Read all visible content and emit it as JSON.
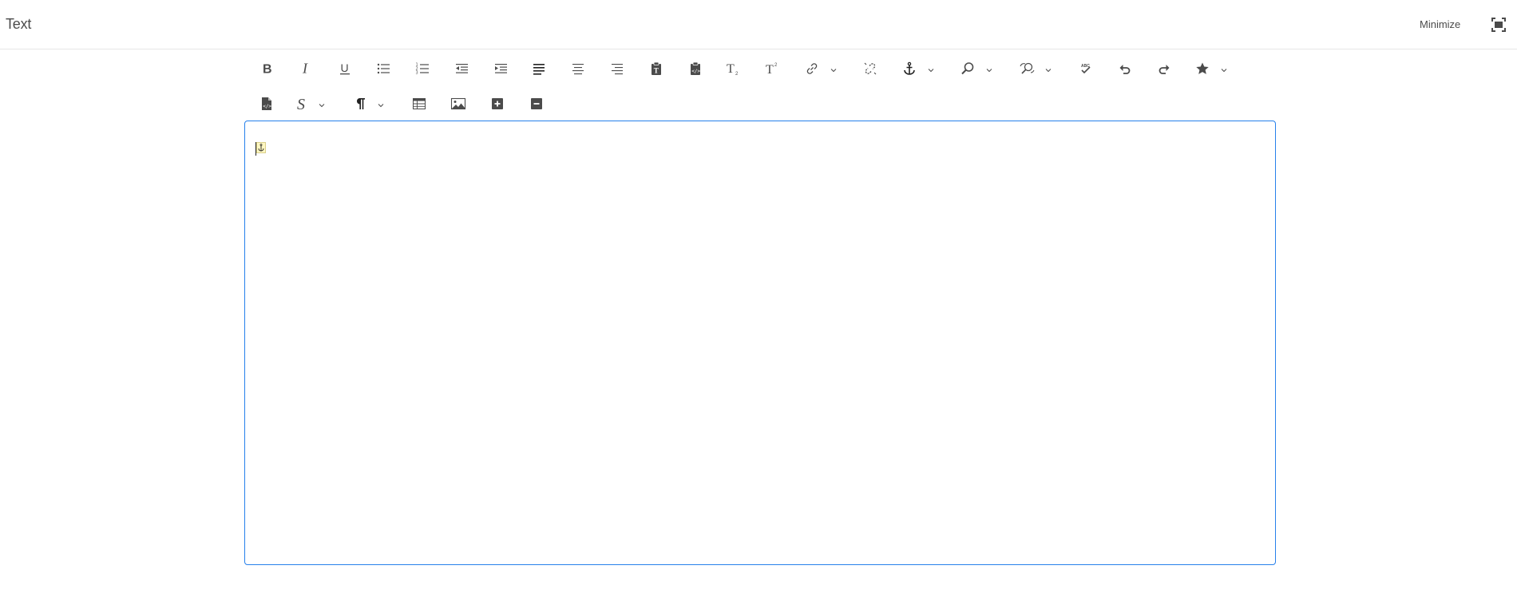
{
  "header": {
    "title": "Text",
    "minimize_label": "Minimize"
  },
  "toolbar": {
    "row1": [
      {
        "name": "bold-button",
        "icon": "bold-icon",
        "dropdown": false
      },
      {
        "name": "italic-button",
        "icon": "italic-icon",
        "dropdown": false
      },
      {
        "name": "underline-button",
        "icon": "underline-icon",
        "dropdown": false
      },
      {
        "name": "bulleted-list-button",
        "icon": "bulleted-list-icon",
        "dropdown": false
      },
      {
        "name": "numbered-list-button",
        "icon": "numbered-list-icon",
        "dropdown": false
      },
      {
        "name": "outdent-button",
        "icon": "outdent-icon",
        "dropdown": false
      },
      {
        "name": "indent-button",
        "icon": "indent-icon",
        "dropdown": false
      },
      {
        "name": "align-left-button",
        "icon": "align-left-icon",
        "dropdown": false
      },
      {
        "name": "align-center-button",
        "icon": "align-center-icon",
        "dropdown": false
      },
      {
        "name": "align-right-button",
        "icon": "align-right-icon",
        "dropdown": false
      },
      {
        "name": "paste-as-text-button",
        "icon": "paste-text-icon",
        "dropdown": false
      },
      {
        "name": "paste-from-word-button",
        "icon": "paste-code-icon",
        "dropdown": false
      },
      {
        "name": "subscript-button",
        "icon": "subscript-icon",
        "dropdown": false
      },
      {
        "name": "superscript-button",
        "icon": "superscript-icon",
        "dropdown": false
      },
      {
        "name": "link-button",
        "icon": "link-icon",
        "dropdown": true
      },
      {
        "name": "unlink-button",
        "icon": "unlink-icon",
        "dropdown": false
      },
      {
        "name": "anchor-button",
        "icon": "anchor-icon",
        "dropdown": true
      },
      {
        "name": "find-button",
        "icon": "find-icon",
        "dropdown": true
      },
      {
        "name": "find-replace-button",
        "icon": "find-replace-icon",
        "dropdown": true
      },
      {
        "name": "spellcheck-button",
        "icon": "spellcheck-icon",
        "dropdown": false
      },
      {
        "name": "undo-button",
        "icon": "undo-icon",
        "dropdown": false
      },
      {
        "name": "redo-button",
        "icon": "redo-icon",
        "dropdown": false
      },
      {
        "name": "special-characters-button",
        "icon": "star-icon",
        "dropdown": true
      }
    ],
    "row2": [
      {
        "name": "source-edit-button",
        "icon": "source-file-icon",
        "dropdown": false
      },
      {
        "name": "styles-button",
        "icon": "styles-icon",
        "dropdown": true
      },
      {
        "name": "paragraph-format-button",
        "icon": "pilcrow-icon",
        "dropdown": true
      },
      {
        "name": "table-button",
        "icon": "table-icon",
        "dropdown": false
      },
      {
        "name": "image-button",
        "icon": "image-icon",
        "dropdown": false
      },
      {
        "name": "expand-all-button",
        "icon": "plus-square-icon",
        "dropdown": false
      },
      {
        "name": "collapse-all-button",
        "icon": "minus-square-icon",
        "dropdown": false
      }
    ]
  },
  "editor": {
    "content": "",
    "marker_icon": "anchor-marker-icon"
  },
  "colors": {
    "accent": "#2680eb",
    "icon": "#4b4b4b",
    "text": "#323232"
  }
}
